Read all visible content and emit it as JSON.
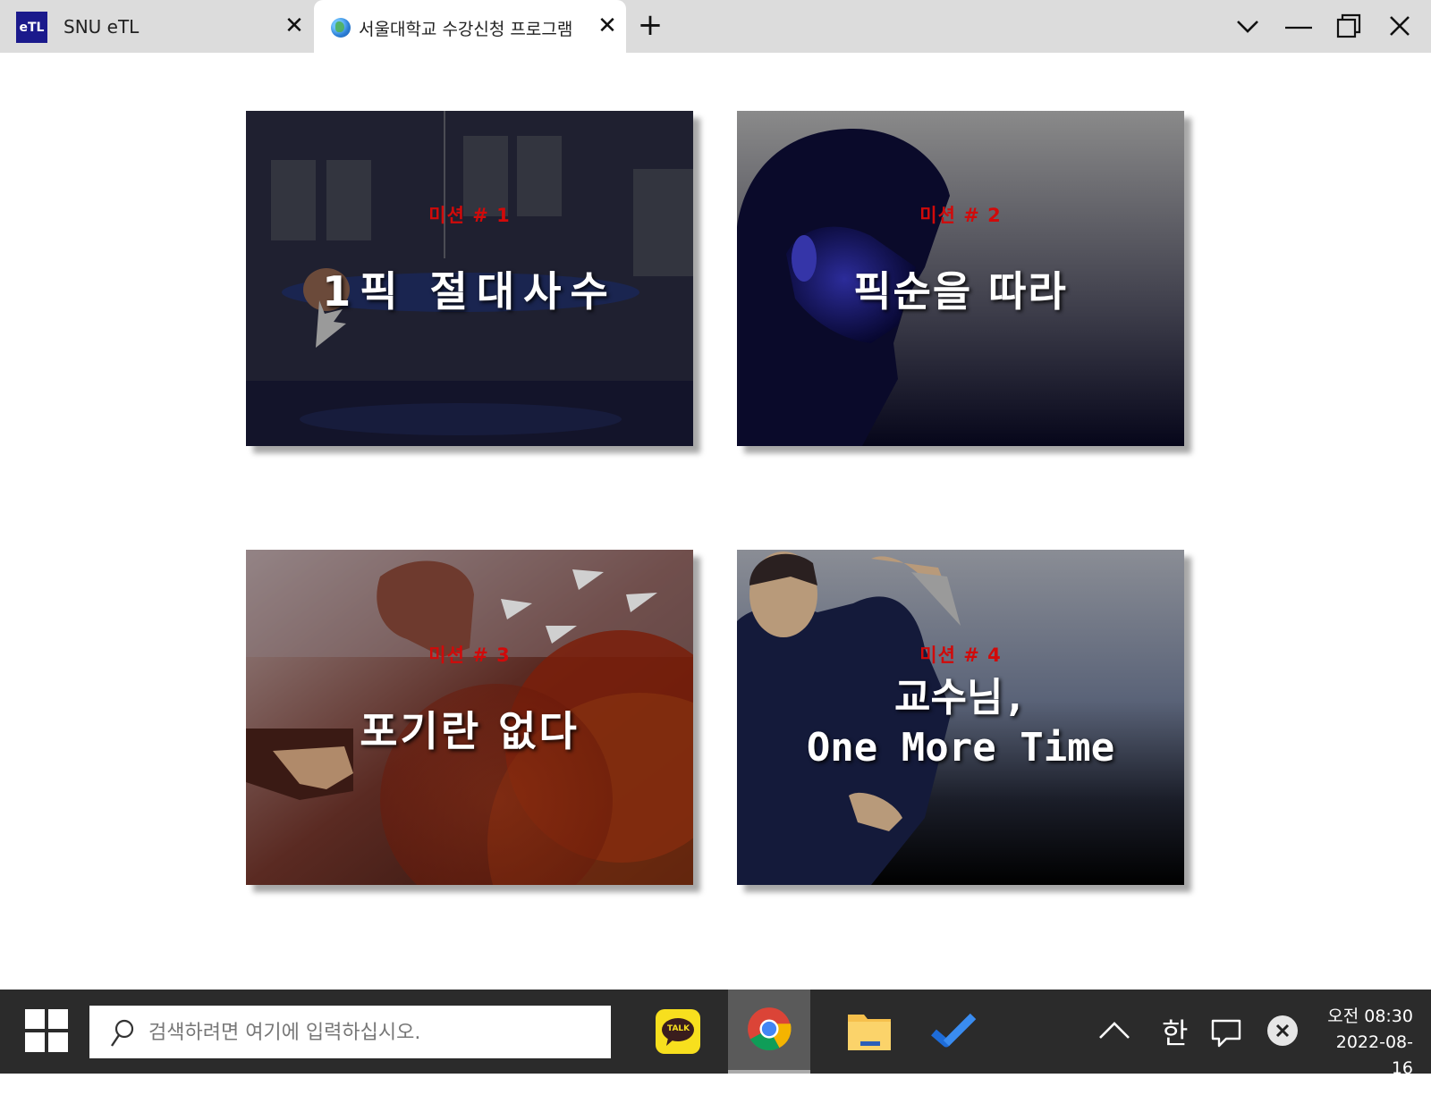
{
  "browser": {
    "tabs": [
      {
        "favicon": "eTL",
        "title": "SNU eTL",
        "active": false
      },
      {
        "favicon": "globe-icon",
        "title": "서울대학교 수강신청 프로그램",
        "active": true
      }
    ],
    "new_tab_icon": "plus-icon",
    "window_controls": [
      "tab-search-chevron-icon",
      "minimize-icon",
      "restore-icon",
      "close-icon"
    ]
  },
  "missions": [
    {
      "label": "미션 # 1",
      "title": "1픽 절대사수",
      "theme": "dark-navy"
    },
    {
      "label": "미션 # 2",
      "title": "픽순을 따라",
      "theme": "grey-to-navy"
    },
    {
      "label": "미션 # 3",
      "title": "포기란 없다",
      "theme": "red-brown"
    },
    {
      "label": "미션 # 4",
      "title_line1": "교수님,",
      "title_line2": "One More Time",
      "theme": "slate-to-black"
    }
  ],
  "colors": {
    "mission_label": "#d10a0a",
    "taskbar": "#2b2b2b",
    "tabbar": "#dcdcdc",
    "etl_brand": "#1b1a8c"
  },
  "taskbar": {
    "search_placeholder": "검색하려면 여기에 입력하십시오.",
    "apps": [
      "kakaotalk-icon",
      "chrome-icon",
      "file-explorer-icon",
      "todo-icon"
    ],
    "kakao_label": "TALK",
    "ime": "한",
    "time": "오전 08:30",
    "date": "2022-08-16"
  }
}
